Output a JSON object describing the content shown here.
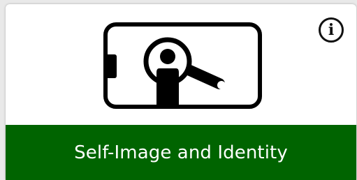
{
  "card": {
    "title": "Self-Image and Identity",
    "info_icon_glyph": "i",
    "info_icon": "info-circle-icon",
    "illustration_icon": "phone-selfie-magnifier-icon",
    "colors": {
      "footer_background": "#006400",
      "footer_text": "#ffffff",
      "icon": "#000000",
      "card_background": "#ffffff"
    }
  }
}
